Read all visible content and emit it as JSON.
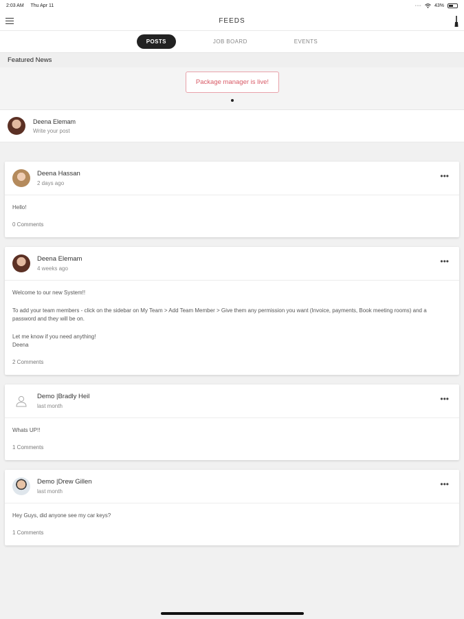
{
  "status_bar": {
    "time": "2:03 AM",
    "date": "Thu Apr 11",
    "battery": "43%",
    "battery_level": 0.43
  },
  "header": {
    "title": "FEEDS"
  },
  "tabs": [
    {
      "label": "POSTS",
      "active": true
    },
    {
      "label": "JOB BOARD",
      "active": false
    },
    {
      "label": "EVENTS",
      "active": false
    }
  ],
  "featured": {
    "section_label": "Featured News",
    "item_label": "Package manager is live!",
    "current_page": 1,
    "page_count": 1
  },
  "composer": {
    "user_name": "Deena Elemam",
    "placeholder": "Write your post"
  },
  "posts": [
    {
      "author": "Deena Hassan",
      "time": "2 days ago",
      "avatar": "woman-light",
      "text": [
        "Hello!"
      ],
      "comments": "0 Comments"
    },
    {
      "author": "Deena Elemam",
      "time": "4 weeks ago",
      "avatar": "woman-dark",
      "text": [
        "Welcome to our new System!!",
        "To add your team members - click on the sidebar on My Team > Add Team Member > Give them any permission you want (Invoice, payments, Book meeting rooms) and a password and they will be on.",
        "Let me know if you need anything!",
        "Deena"
      ],
      "comments": "2 Comments"
    },
    {
      "author": "Demo |Bradly Heil",
      "time": "last month",
      "avatar": "placeholder",
      "text": [
        "Whats UP!!"
      ],
      "comments": "1 Comments"
    },
    {
      "author": "Demo |Drew Gillen",
      "time": "last month",
      "avatar": "man-beard",
      "text": [
        "Hey Guys, did anyone see my car keys?"
      ],
      "comments": "1 Comments"
    }
  ],
  "icons": {
    "menu": "hamburger-menu-icon",
    "tool": "brush-icon",
    "more": "more-options-icon",
    "wifi": "wifi-icon",
    "battery": "battery-icon"
  }
}
